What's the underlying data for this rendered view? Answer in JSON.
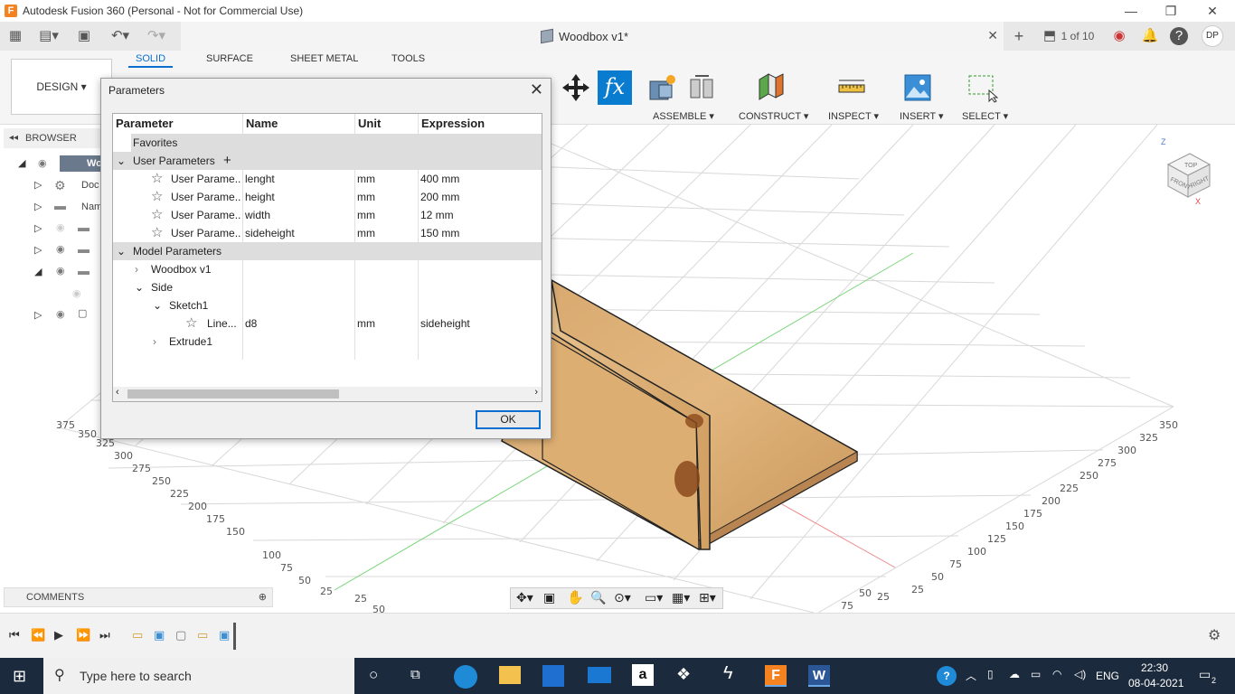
{
  "window": {
    "title": "Autodesk Fusion 360 (Personal - Not for Commercial Use)",
    "app_icon": "F",
    "minimize": "—",
    "maximize": "❐",
    "close": "✕"
  },
  "tabbar": {
    "document_title": "Woodbox v1*",
    "version_label": "1 of 10",
    "user_initials": "DP",
    "doc_close": "✕",
    "new_tab": "+",
    "help": "?"
  },
  "toolbar": {
    "design_label": "DESIGN ▾",
    "workspace_tabs": [
      "SOLID",
      "SURFACE",
      "SHEET METAL",
      "TOOLS"
    ],
    "groups": [
      "ASSEMBLE ▾",
      "CONSTRUCT ▾",
      "INSPECT ▾",
      "INSERT ▾",
      "SELECT ▾"
    ],
    "fx_label": "fx"
  },
  "browser": {
    "title": "BROWSER",
    "root_label": "Wo",
    "items": [
      "Doc",
      "Nam"
    ]
  },
  "comments": {
    "title": "COMMENTS"
  },
  "dialog": {
    "title": "Parameters",
    "columns": [
      "Parameter",
      "Name",
      "Unit",
      "Expression"
    ],
    "favorites_label": "Favorites",
    "user_params_label": "User Parameters",
    "user_params": [
      {
        "parameter": "User Parame...",
        "name": "lenght",
        "unit": "mm",
        "expression": "400 mm"
      },
      {
        "parameter": "User Parame...",
        "name": "height",
        "unit": "mm",
        "expression": "200 mm"
      },
      {
        "parameter": "User Parame...",
        "name": "width",
        "unit": "mm",
        "expression": "12 mm"
      },
      {
        "parameter": "User Parame...",
        "name": "sideheight",
        "unit": "mm",
        "expression": "150 mm"
      }
    ],
    "model_params_label": "Model Parameters",
    "model_tree": {
      "component1": "Woodbox v1",
      "component2": "Side",
      "sketch": "Sketch1",
      "line": {
        "parameter": "Line...",
        "name": "d8",
        "unit": "mm",
        "expression": "sideheight"
      },
      "extrude": "Extrude1"
    },
    "ok_label": "OK"
  },
  "viewcube": {
    "top": "TOP",
    "front": "FRONT",
    "right": "RIGHT",
    "z": "Z",
    "x": "X"
  },
  "grid_labels": {
    "left": [
      "375",
      "350",
      "325",
      "300",
      "275",
      "250",
      "225",
      "200",
      "175",
      "150",
      "100",
      "75",
      "50",
      "25",
      "25",
      "50"
    ],
    "right": [
      "350",
      "325",
      "300",
      "275",
      "250",
      "225",
      "200",
      "175",
      "150",
      "125",
      "100",
      "75",
      "50",
      "25",
      "25",
      "50",
      "75"
    ]
  },
  "taskbar": {
    "search_placeholder": "Type here to search",
    "language": "ENG",
    "time": "22:30",
    "date": "08-04-2021",
    "notification_count": "2"
  }
}
